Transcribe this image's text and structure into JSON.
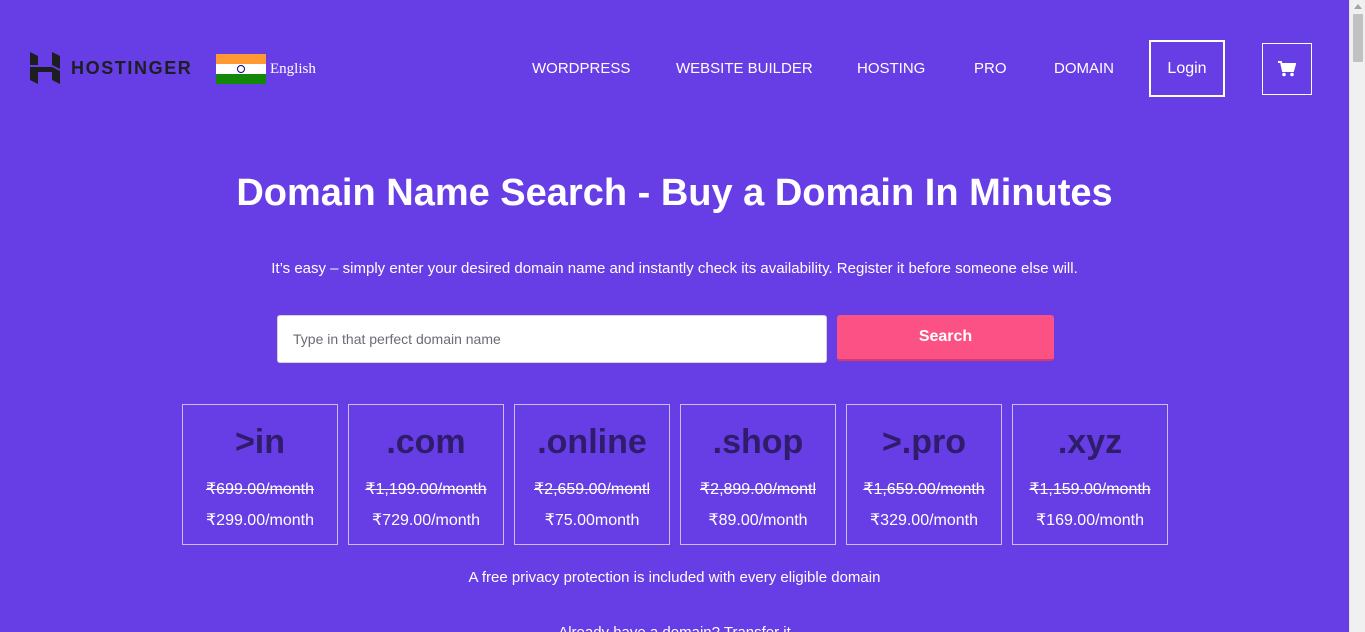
{
  "header": {
    "brand": "HOSTINGER",
    "language": "English",
    "nav": [
      {
        "label": "WORDPRESS",
        "name": "nav-wordpress"
      },
      {
        "label": "WEBSITE BUILDER",
        "name": "nav-website-builder"
      },
      {
        "label": "HOSTING",
        "name": "nav-hosting"
      },
      {
        "label": "PRO",
        "name": "nav-pro"
      },
      {
        "label": "DOMAIN",
        "name": "nav-domain"
      }
    ],
    "login_label": "Login",
    "cart_icon": "cart-icon"
  },
  "hero": {
    "title": "Domain Name Search - Buy a Domain In Minutes",
    "subtitle": "It’s easy – simply enter your desired domain name and instantly check its availability. Register it before someone else will."
  },
  "search": {
    "placeholder": "Type in that perfect domain name",
    "value": "",
    "button_label": "Search"
  },
  "domains": [
    {
      "tld": ">in",
      "old_price": "₹699.00/month",
      "new_price": "₹299.00/month"
    },
    {
      "tld": ".com",
      "old_price": "₹1,199.00/month",
      "new_price": "₹729.00/month"
    },
    {
      "tld": ".online",
      "old_price": "₹2,659.00/montl",
      "new_price": "₹75.00month"
    },
    {
      "tld": ".shop",
      "old_price": "₹2,899.00/montl",
      "new_price": "₹89.00/month"
    },
    {
      "tld": ">.pro",
      "old_price": "₹1,659.00/month",
      "new_price": "₹329.00/month"
    },
    {
      "tld": ".xyz",
      "old_price": "₹1,159.00/month",
      "new_price": "₹169.00/month"
    }
  ],
  "notes": {
    "privacy": "A free privacy protection is included with every eligible domain",
    "transfer": "Already have a domain? Transfer it"
  },
  "colors": {
    "background": "#673de6",
    "search_button": "#fc5185",
    "tld_text": "#2f1c6a",
    "logo": "#1d1e20"
  }
}
